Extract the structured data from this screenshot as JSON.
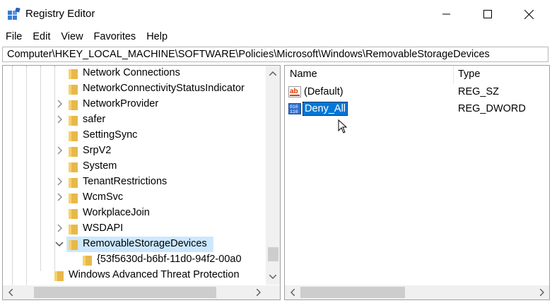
{
  "window": {
    "title": "Registry Editor",
    "controls": {
      "minimize": "minimize-icon",
      "maximize": "maximize-icon",
      "close": "close-icon"
    }
  },
  "menu": [
    "File",
    "Edit",
    "View",
    "Favorites",
    "Help"
  ],
  "address": "Computer\\HKEY_LOCAL_MACHINE\\SOFTWARE\\Policies\\Microsoft\\Windows\\RemovableStorageDevices",
  "tree": {
    "items": [
      {
        "label": "Network Connections",
        "expander": "none"
      },
      {
        "label": "NetworkConnectivityStatusIndicator",
        "expander": "none"
      },
      {
        "label": "NetworkProvider",
        "expander": "collapsed"
      },
      {
        "label": "safer",
        "expander": "collapsed"
      },
      {
        "label": "SettingSync",
        "expander": "none"
      },
      {
        "label": "SrpV2",
        "expander": "collapsed"
      },
      {
        "label": "System",
        "expander": "none"
      },
      {
        "label": "TenantRestrictions",
        "expander": "collapsed"
      },
      {
        "label": "WcmSvc",
        "expander": "collapsed"
      },
      {
        "label": "WorkplaceJoin",
        "expander": "none"
      },
      {
        "label": "WSDAPI",
        "expander": "collapsed"
      },
      {
        "label": "RemovableStorageDevices",
        "expander": "expanded",
        "selected": true
      },
      {
        "label": "{53f5630d-b6bf-11d0-94f2-00a0",
        "expander": "none",
        "child": true
      },
      {
        "label": "Windows Advanced Threat Protection",
        "expander": "none",
        "parent_level": true
      }
    ]
  },
  "list": {
    "columns": [
      "Name",
      "Type"
    ],
    "rows": [
      {
        "name": "(Default)",
        "type": "REG_SZ",
        "icon": "string-value-icon"
      },
      {
        "name": "Deny_All",
        "type": "REG_DWORD",
        "icon": "dword-value-icon",
        "editing": true
      }
    ]
  },
  "colors": {
    "selection": "#0078d7",
    "folder": "#e8b84a",
    "selected_row": "#cce8ff"
  }
}
